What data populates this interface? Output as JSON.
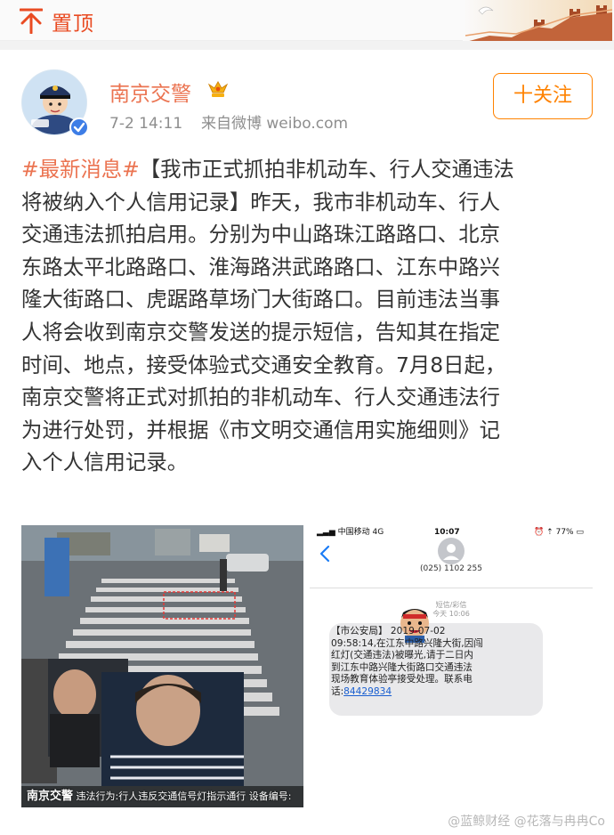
{
  "topbar": {
    "pin_label": "置顶",
    "pin_icon": "pin-top-icon",
    "decor_icon": "great-wall-dove-icon"
  },
  "post": {
    "author": "南京交警",
    "vip_icon": "vip-badge-icon",
    "verified_icon": "verified-badge-icon",
    "time": "7-2 14:11",
    "source": "来自微博 weibo.com",
    "follow_label": "十关注",
    "lines": [
      {
        "hashtag": "#最新消息#",
        "text": "【我市正式抓拍非机动车、行人交通违法"
      },
      {
        "hashtag": "",
        "text": "将被纳入个人信用记录】昨天，我市非机动车、行人"
      },
      {
        "hashtag": "",
        "text": "交通违法抓拍启用。分别为中山路珠江路路口、北京"
      },
      {
        "hashtag": "",
        "text": "东路太平北路路口、淮海路洪武路路口、江东中路兴"
      },
      {
        "hashtag": "",
        "text": "隆大街路口、虎踞路草场门大街路口。目前违法当事"
      },
      {
        "hashtag": "",
        "text": "人将会收到南京交警发送的提示短信，告知其在指定"
      },
      {
        "hashtag": "",
        "text": "时间、地点，接受体验式交通安全教育。7月8日起，"
      },
      {
        "hashtag": "",
        "text": "南京交警将正式对抓拍的非机动车、行人交通违法行"
      },
      {
        "hashtag": "",
        "text": "为进行处罚，并根据《市文明交通信用实施细则》记"
      },
      {
        "hashtag": "",
        "text": "入个人信用记录。"
      }
    ]
  },
  "photo1": {
    "caption_brand": "南京交警",
    "caption_rest": "违法行为:行人违反交通信号灯指示通行 设备编号:"
  },
  "photo2": {
    "carrier": "中国移动",
    "network": "4G",
    "clock": "10:07",
    "battery": "77%",
    "contact": "(025) 1102 255",
    "sms_label": "短信/彩信",
    "sms_time": "今天 10:06",
    "message_lines": [
      "【市公安局】         2019-07-02",
      "09:58:14,在江东中路兴隆大街,因闯",
      "红灯(交通违法)被曝光,请于二日内",
      "到江东中路兴隆大街路口交通违法",
      "现场教育体验亭接受处理。联系电"
    ],
    "tel_prefix": "话:",
    "tel_number": "84429834"
  },
  "watermark": "@蓝鲸财经 @花落与冉冉Co"
}
